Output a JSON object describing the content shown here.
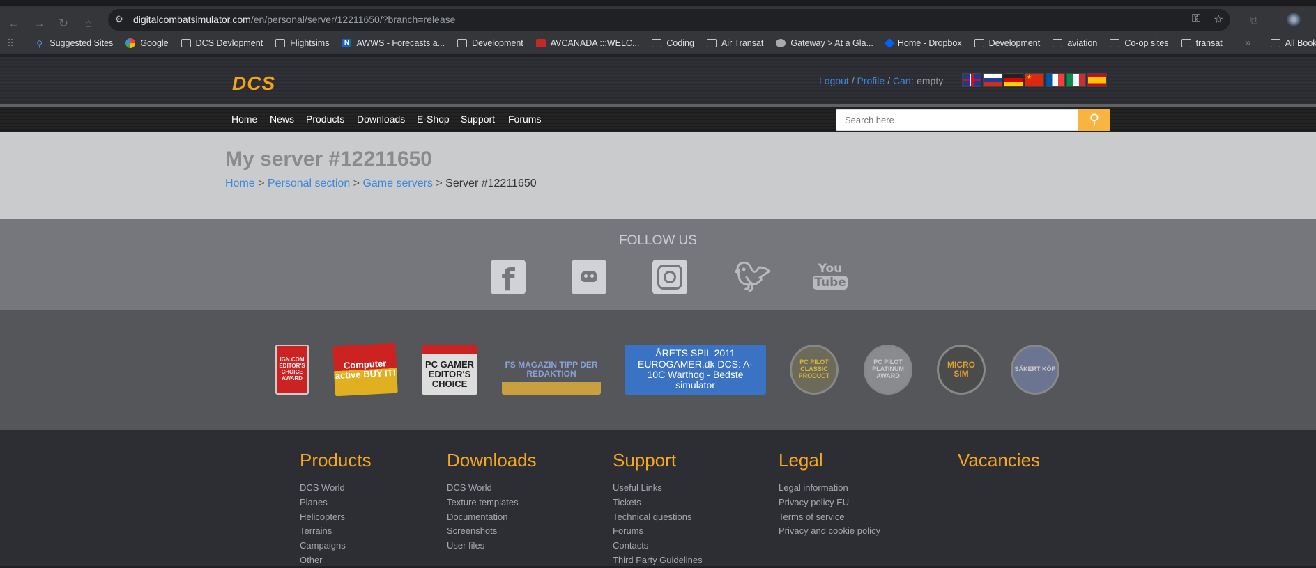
{
  "browser": {
    "url_host": "digitalcombatsimulator.com",
    "url_path": "/en/personal/server/12211650/?branch=release",
    "bookmarks": [
      {
        "label": "Suggested Sites",
        "icon": "search"
      },
      {
        "label": "Google",
        "icon": "google"
      },
      {
        "label": "DCS Devlopment",
        "icon": "folder"
      },
      {
        "label": "Flightsims",
        "icon": "folder"
      },
      {
        "label": "AWWS - Forecasts a...",
        "icon": "n"
      },
      {
        "label": "Development",
        "icon": "folder"
      },
      {
        "label": "AVCANADA :::WELC...",
        "icon": "avcanada"
      },
      {
        "label": "Coding",
        "icon": "folder"
      },
      {
        "label": "Air Transat",
        "icon": "folder"
      },
      {
        "label": "Gateway > At a Gla...",
        "icon": "globe"
      },
      {
        "label": "Home - Dropbox",
        "icon": "dropbox"
      },
      {
        "label": "Development",
        "icon": "folder"
      },
      {
        "label": "aviation",
        "icon": "folder"
      },
      {
        "label": "Co-op sites",
        "icon": "folder"
      },
      {
        "label": "transat",
        "icon": "folder"
      }
    ],
    "all_bookmarks": "All Bookmarks"
  },
  "header": {
    "logo": "DCS",
    "logout": "Logout",
    "profile": "Profile",
    "cart_label": "Cart:",
    "cart_value": "empty",
    "flags": [
      "en",
      "ru",
      "de",
      "cn",
      "fr",
      "it",
      "es"
    ]
  },
  "nav": {
    "items": [
      "Home",
      "News",
      "Products",
      "Downloads",
      "E-Shop",
      "Support",
      "Forums"
    ],
    "search_placeholder": "Search here"
  },
  "page": {
    "title": "My server #12211650",
    "breadcrumb": [
      "Home",
      "Personal section",
      "Game servers"
    ],
    "breadcrumb_current": "Server #12211650"
  },
  "follow": {
    "title": "FOLLOW US",
    "networks": [
      "facebook",
      "discord",
      "instagram",
      "twitter",
      "youtube"
    ]
  },
  "awards": [
    "IGN.COM EDITOR'S CHOICE AWARD",
    "Computer active BUY IT!",
    "PC GAMER EDITOR'S CHOICE",
    "FS MAGAZIN TIPP DER REDAKTION",
    "ÅRETS SPIL 2011 EUROGAMER.dk DCS: A-10C Warthog - Bedste simulator",
    "PC PILOT CLASSIC PRODUCT",
    "PC PILOT PLATINUM AWARD",
    "MICRO SIM",
    "SÄKERT KÖP"
  ],
  "footer": [
    {
      "heading": "Products",
      "links": [
        "DCS World",
        "Planes",
        "Helicopters",
        "Terrains",
        "Campaigns",
        "Other"
      ]
    },
    {
      "heading": "Downloads",
      "links": [
        "DCS World",
        "Texture templates",
        "Documentation",
        "Screenshots",
        "User files"
      ]
    },
    {
      "heading": "Support",
      "links": [
        "Useful Links",
        "Tickets",
        "Technical questions",
        "Forums",
        "Contacts",
        "Third Party Guidelines"
      ]
    },
    {
      "heading": "Legal",
      "links": [
        "Legal information",
        "Privacy policy EU",
        "Terms of service",
        "Privacy and cookie policy"
      ]
    },
    {
      "heading": "Vacancies",
      "links": []
    }
  ]
}
